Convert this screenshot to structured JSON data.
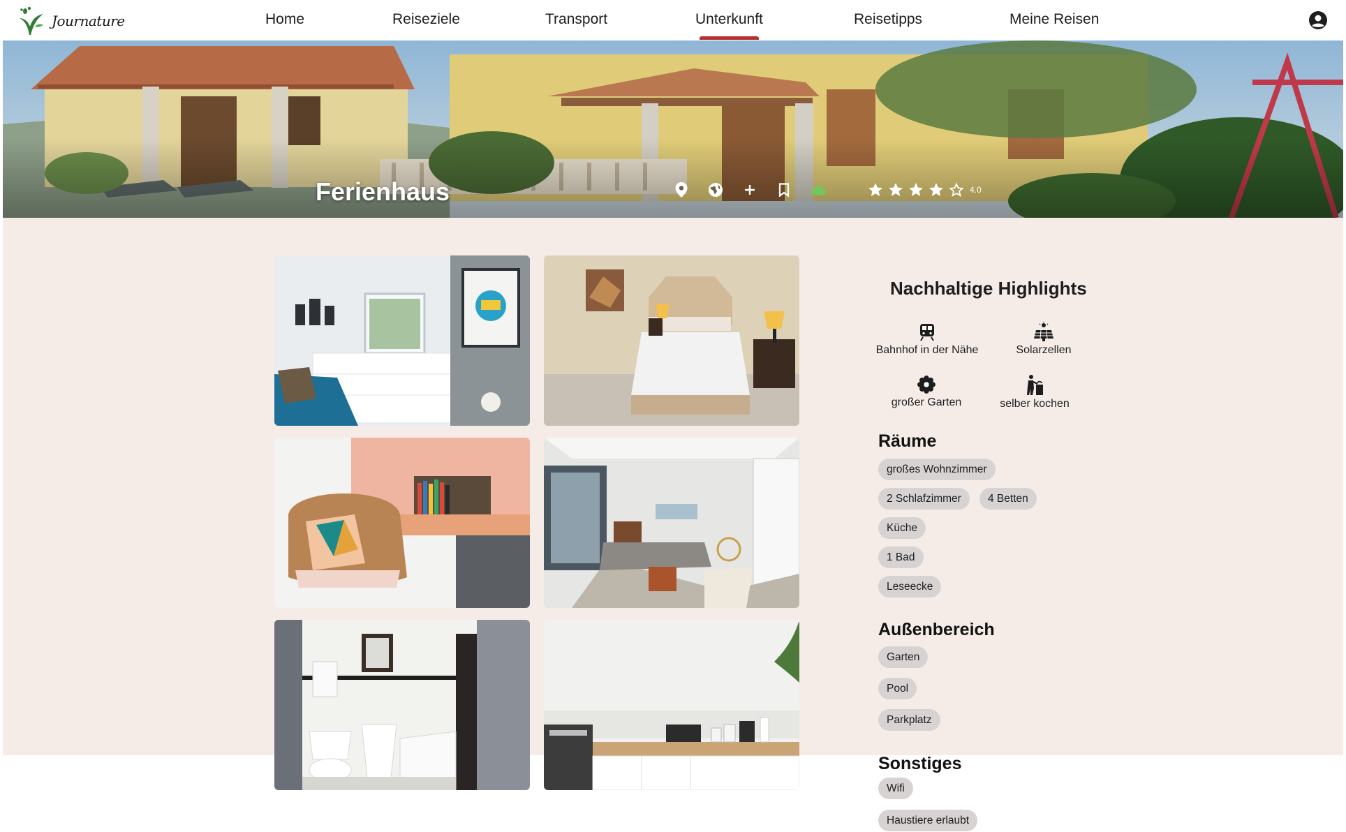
{
  "brand": {
    "name": "Journature"
  },
  "nav": {
    "items": [
      "Home",
      "Reiseziele",
      "Transport",
      "Unterkunft",
      "Reisetipps",
      "Meine Reisen"
    ],
    "active": "Unterkunft"
  },
  "hero": {
    "title": "Ferienhaus",
    "icons": [
      "location-pin-icon",
      "globe-icon",
      "plus-icon",
      "bookmark-icon",
      "cloud-icon"
    ],
    "rating": {
      "value": 4.0,
      "label": "4.0",
      "max": 5
    },
    "colors": {
      "cloud": "#74c55b",
      "star": "#ffffff"
    }
  },
  "gallery": {
    "photos": [
      "bedroom-white-blue",
      "bedroom-beige",
      "reading-corner",
      "living-room",
      "bathroom",
      "kitchen"
    ]
  },
  "highlights": {
    "title": "Nachhaltige Highlights",
    "items": [
      {
        "icon": "train-icon",
        "label": "Bahnhof in der Nähe"
      },
      {
        "icon": "solar-panel-icon",
        "label": "Solarzellen"
      },
      {
        "icon": "flower-icon",
        "label": "großer Garten"
      },
      {
        "icon": "cooking-person-icon",
        "label": "selber kochen"
      }
    ]
  },
  "sections": {
    "rooms": {
      "title": "Räume",
      "tags": [
        "großes Wohnzimmer",
        "2 Schlafzimmer",
        "4 Betten",
        "Küche",
        "1 Bad",
        "Leseecke"
      ]
    },
    "outdoor": {
      "title": "Außenbereich",
      "tags": [
        "Garten",
        "Pool",
        "Parkplatz"
      ]
    },
    "other": {
      "title": "Sonstiges",
      "tags": [
        "Wifi",
        "Haustiere erlaubt"
      ]
    }
  },
  "colors": {
    "accent": "#b5322c",
    "content_bg": "#f5ece8",
    "chip_bg": "#d6d3d2"
  }
}
